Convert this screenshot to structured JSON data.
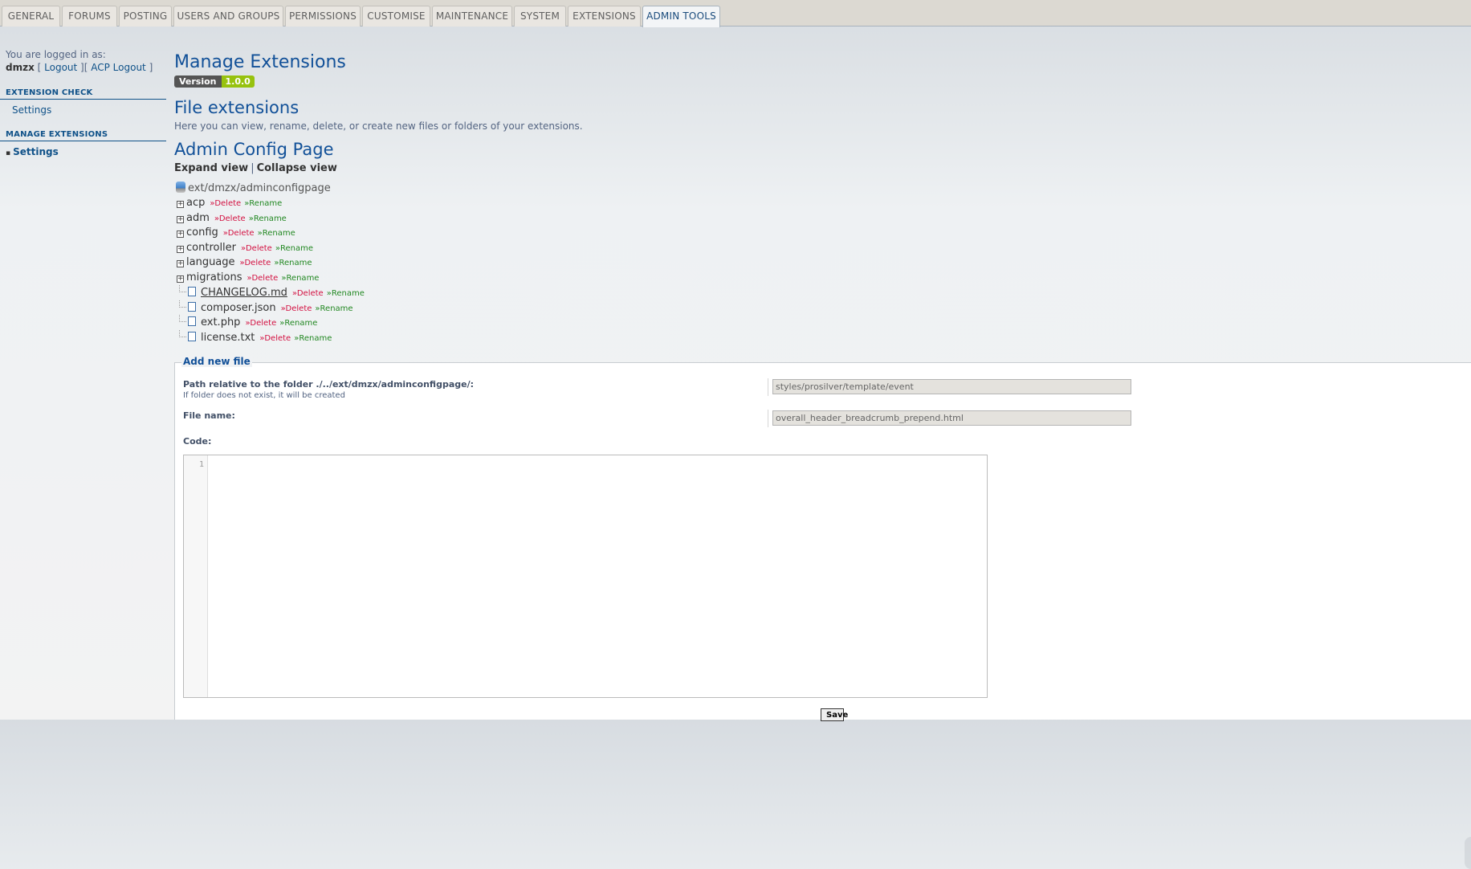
{
  "tabs": [
    {
      "label": "GENERAL",
      "active": false
    },
    {
      "label": "FORUMS",
      "active": false
    },
    {
      "label": "POSTING",
      "active": false
    },
    {
      "label": "USERS AND GROUPS",
      "active": false
    },
    {
      "label": "PERMISSIONS",
      "active": false
    },
    {
      "label": "CUSTOMISE",
      "active": false
    },
    {
      "label": "MAINTENANCE",
      "active": false
    },
    {
      "label": "SYSTEM",
      "active": false
    },
    {
      "label": "EXTENSIONS",
      "active": false
    },
    {
      "label": "ADMIN TOOLS",
      "active": true
    }
  ],
  "sidebar": {
    "logged_in_as": "You are logged in as:",
    "username": "dmzx",
    "logout": "Logout",
    "acp_logout": "ACP Logout",
    "sections": [
      {
        "heading": "EXTENSION CHECK",
        "items": [
          {
            "label": "Settings",
            "current": false
          }
        ]
      },
      {
        "heading": "MANAGE EXTENSIONS",
        "items": [
          {
            "label": "Settings",
            "current": true
          }
        ]
      }
    ]
  },
  "main": {
    "title": "Manage Extensions",
    "version_label": "Version",
    "version_value": "1.0.0",
    "subtitle": "File extensions",
    "description": "Here you can view, rename, delete, or create new files or folders of your extensions.",
    "extension_name": "Admin Config Page",
    "expand_view": "Expand view",
    "separator": "|",
    "collapse_view": "Collapse view",
    "tree_root": "ext/dmzx/adminconfigpage",
    "delete_label": "»Delete",
    "rename_label": "»Rename",
    "folders": [
      "acp",
      "adm",
      "config",
      "controller",
      "language",
      "migrations"
    ],
    "files": [
      "CHANGELOG.md",
      "composer.json",
      "ext.php",
      "license.txt"
    ]
  },
  "form": {
    "legend": "Add new file",
    "path_label": "Path relative to the folder ./../ext/dmzx/adminconfigpage/:",
    "path_hint": "If folder does not exist, it will be created",
    "path_value": "styles/prosilver/template/event",
    "filename_label": "File name:",
    "filename_value": "overall_header_breadcrumb_prepend.html",
    "code_label": "Code:",
    "line_number": "1",
    "save_label": "Save"
  },
  "colors": {
    "accent": "#115098",
    "delete": "#d31141",
    "rename": "#228822",
    "version_badge": "#97c20e"
  }
}
